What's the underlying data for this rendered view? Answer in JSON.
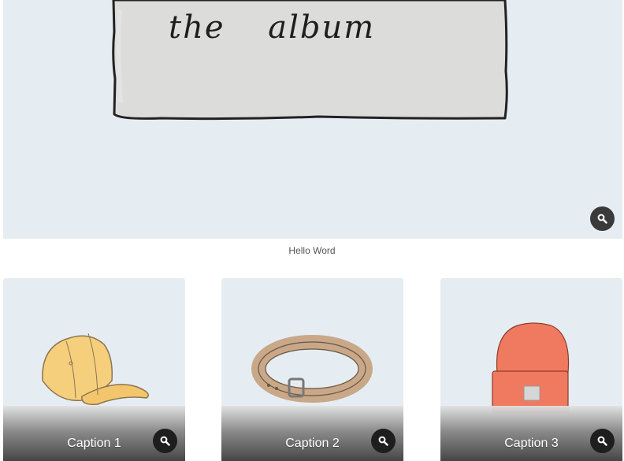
{
  "hero": {
    "title": "the album",
    "caption": "Hello Word",
    "zoom_icon": "magnifier-icon"
  },
  "cards": [
    {
      "caption": "Caption 1",
      "item": "cap",
      "zoom_icon": "magnifier-icon"
    },
    {
      "caption": "Caption 2",
      "item": "belt",
      "zoom_icon": "magnifier-icon"
    },
    {
      "caption": "Caption 3",
      "item": "beanie",
      "zoom_icon": "magnifier-icon"
    }
  ],
  "colors": {
    "image_background": "#e6edf2",
    "button": "#1e1e1e",
    "cap": "#f5cf7c",
    "belt": "#c8a889",
    "beanie": "#f07a5f"
  }
}
